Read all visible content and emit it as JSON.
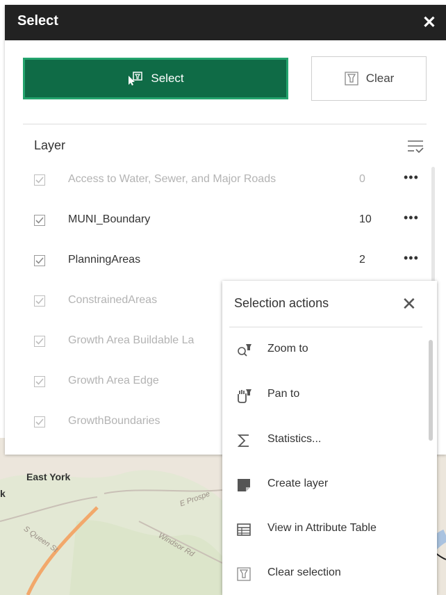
{
  "panel": {
    "title": "Select",
    "close_glyph": "✕",
    "select_button": "Select",
    "clear_button": "Clear",
    "layer_header": "Layer"
  },
  "layers": [
    {
      "name": "Access to Water, Sewer, and Major Roads",
      "count": "0",
      "dimmed": true
    },
    {
      "name": "MUNI_Boundary",
      "count": "10",
      "dimmed": false
    },
    {
      "name": "PlanningAreas",
      "count": "2",
      "dimmed": false
    },
    {
      "name": "ConstrainedAreas",
      "count": "",
      "dimmed": true
    },
    {
      "name": "Growth Area Buildable La",
      "count": "",
      "dimmed": true
    },
    {
      "name": "Growth Area Edge",
      "count": "",
      "dimmed": true
    },
    {
      "name": "GrowthBoundaries",
      "count": "",
      "dimmed": true
    }
  ],
  "more_glyph": "•••",
  "popup": {
    "title": "Selection actions",
    "close_glyph": "✕",
    "actions": [
      {
        "label": "Zoom to",
        "icon": "zoom-to-icon"
      },
      {
        "label": "Pan to",
        "icon": "pan-to-icon"
      },
      {
        "label": "Statistics...",
        "icon": "sigma-icon"
      },
      {
        "label": "Create layer",
        "icon": "create-layer-icon"
      },
      {
        "label": "View in Attribute Table",
        "icon": "table-icon"
      },
      {
        "label": "Clear selection",
        "icon": "clear-selection-icon"
      }
    ]
  },
  "map": {
    "place_label": "East York",
    "edge_label": "k",
    "road_labels": [
      "E Prospe",
      "S Queen St",
      "Windsor Rd"
    ]
  },
  "colors": {
    "titlebar": "#222222",
    "select_fill": "#0f6b46",
    "select_border": "#23a36d"
  }
}
